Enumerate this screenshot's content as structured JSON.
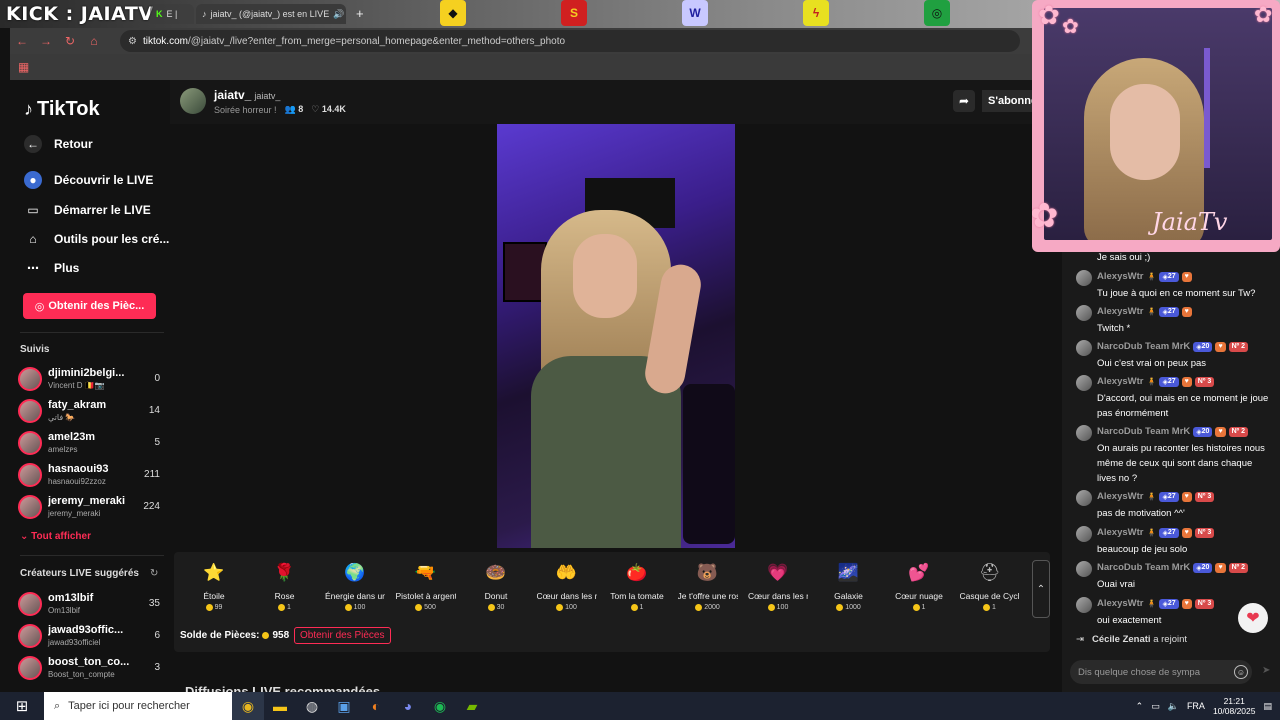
{
  "browser": {
    "overlay_text": "KICK : JAIATV",
    "tabs": [
      {
        "label": "E |",
        "icon": "kick-icon"
      },
      {
        "label": "jaiatv_ (@jaiatv_) est en LIVE",
        "icon": "tiktok-icon"
      }
    ],
    "address": {
      "host": "tiktok.com",
      "path": "/@jaiatv_/live?enter_from_merge=personal_homepage&enter_method=others_photo"
    }
  },
  "sidebar": {
    "logo": "TikTok",
    "back": "Retour",
    "nav": [
      {
        "label": "Découvrir le LIVE",
        "icon": "live-discover-icon"
      },
      {
        "label": "Démarrer le LIVE",
        "icon": "camera-icon"
      },
      {
        "label": "Outils pour les cré...",
        "icon": "home-tools-icon"
      },
      {
        "label": "Plus",
        "icon": "more-icon"
      }
    ],
    "coins_button": "Obtenir des Pièc...",
    "following_title": "Suivis",
    "following": [
      {
        "name": "djimini2belgi...",
        "sub": "Vincent D 🇧🇪📷",
        "count": "0"
      },
      {
        "name": "faty_akram",
        "sub": "فاتي 🐎",
        "count": "14"
      },
      {
        "name": "amel23m",
        "sub": "amelᴢᴘs",
        "count": "5"
      },
      {
        "name": "hasnaoui93",
        "sub": "hasnaoui92ᴢᴢᴏᴢ",
        "count": "211"
      },
      {
        "name": "jeremy_meraki",
        "sub": "jeremy_meraki",
        "count": "224"
      }
    ],
    "see_all": "Tout afficher",
    "suggested_title": "Créateurs LIVE suggérés",
    "suggested": [
      {
        "name": "om13lbif",
        "sub": "Om13lbif",
        "count": "35"
      },
      {
        "name": "jawad93offic...",
        "sub": "jawad93officiel",
        "count": "6"
      },
      {
        "name": "boost_ton_co...",
        "sub": "Boost_ton_compte",
        "count": "3"
      }
    ]
  },
  "stream": {
    "name": "jaiatv_",
    "handle": "jaiatv_",
    "title": "Soirée horreur !",
    "viewers": "8",
    "likes": "14.4K",
    "subscribe": "S'abonner"
  },
  "gifts": {
    "items": [
      {
        "name": "Étoile",
        "price": "99",
        "icon": "⭐",
        "color": "#f5d020"
      },
      {
        "name": "Rose",
        "price": "1",
        "icon": "🌹",
        "color": "#e03030"
      },
      {
        "name": "Énergie dans un ...",
        "price": "100",
        "icon": "🌍",
        "color": "#3a9ad0"
      },
      {
        "name": "Pistolet à argent",
        "price": "500",
        "icon": "🔫",
        "color": "#e8a0c0"
      },
      {
        "name": "Donut",
        "price": "30",
        "icon": "🍩",
        "color": "#f0a0b0"
      },
      {
        "name": "Cœur dans les m...",
        "price": "100",
        "icon": "🤲",
        "color": "#f09090"
      },
      {
        "name": "Tom la tomate",
        "price": "1",
        "icon": "🍅",
        "color": "#e05030"
      },
      {
        "name": "Je t'offre une ros...",
        "price": "2000",
        "icon": "🐻",
        "color": "#c08050"
      },
      {
        "name": "Cœur dans les m...",
        "price": "100",
        "icon": "💗",
        "color": "#f080b0"
      },
      {
        "name": "Galaxie",
        "price": "1000",
        "icon": "🌌",
        "color": "#4a6ad0"
      },
      {
        "name": "Cœur nuage",
        "price": "1",
        "icon": "💕",
        "color": "#f0a8c8"
      },
      {
        "name": "Casque de Cyclis...",
        "price": "1",
        "icon": "⛑",
        "color": "#bbbbbb"
      }
    ],
    "balance_label": "Solde de Pièces:",
    "balance": "958",
    "get_coins": "Obtenir des Pièces"
  },
  "recommended_title": "Diffusions LIVE recommandées",
  "chat": {
    "first_line": "Je sais oui ;)",
    "messages": [
      {
        "user": "AlexysWtr",
        "level": "27",
        "rank": "",
        "text": "Tu joue à quoi en ce moment sur Tw?"
      },
      {
        "user": "AlexysWtr",
        "level": "27",
        "rank": "",
        "text": "Twitch *"
      },
      {
        "user": "NarcoDub Team MrK",
        "level": "20",
        "rank": "Nº 2",
        "text": "Oui c'est vrai on peux pas"
      },
      {
        "user": "AlexysWtr",
        "level": "27",
        "rank": "Nº 3",
        "text": "D'accord, oui mais en ce moment je joue pas énormément"
      },
      {
        "user": "NarcoDub Team MrK",
        "level": "20",
        "rank": "Nº 2",
        "text": "On aurais pu raconter les histoires nous même de ceux qui sont dans chaque lives no ?"
      },
      {
        "user": "AlexysWtr",
        "level": "27",
        "rank": "Nº 3",
        "text": "pas de motivation ^^'"
      },
      {
        "user": "AlexysWtr",
        "level": "27",
        "rank": "Nº 3",
        "text": "beaucoup de jeu solo"
      },
      {
        "user": "NarcoDub Team MrK",
        "level": "20",
        "rank": "Nº 2",
        "text": "Ouai vrai"
      },
      {
        "user": "AlexysWtr",
        "level": "27",
        "rank": "Nº 3",
        "text": "oui exactement"
      }
    ],
    "joined_user": "Cécile Zenati",
    "joined_text": "a rejoint",
    "input_placeholder": "Dis quelque chose de sympa"
  },
  "webcam": {
    "signature": "JaiaTv"
  },
  "taskbar": {
    "search_placeholder": "Taper ici pour rechercher",
    "language": "FRA",
    "time": "21:21",
    "date": "10/08/2025"
  }
}
